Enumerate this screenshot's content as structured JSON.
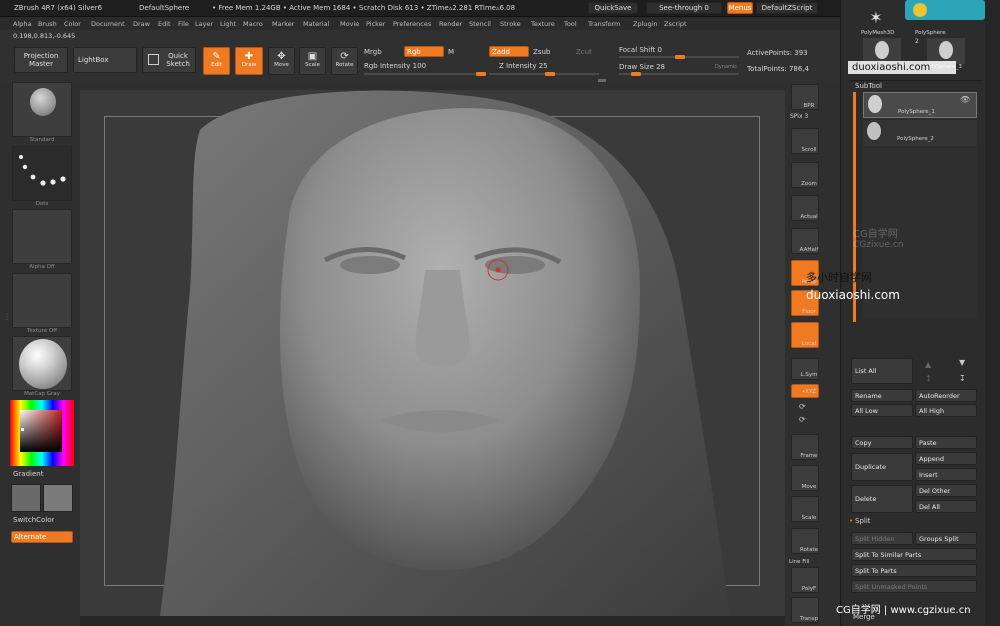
{
  "title_bar": {
    "app": "ZBrush 4R7 (x64) Silver6",
    "document": "DefaultSphere",
    "free_mem": "• Free Mem 1.24GB • Active Mem 1684 • Scratch Disk 613 • ZTime▵2.281 RTime▵6.08",
    "quicksave": "QuickSave",
    "see_through": "See-through  0",
    "menus": "Menus",
    "default_zscript": "DefaultZScript"
  },
  "coords": "0.198,0.813,-0.645",
  "menu": [
    "Alpha",
    "Brush",
    "Color",
    "Document",
    "Draw",
    "Edit",
    "File",
    "Layer",
    "Light",
    "Macro",
    "Marker",
    "Material",
    "Movie",
    "Picker",
    "Preferences",
    "Render",
    "Stencil",
    "Stroke",
    "Texture",
    "Tool",
    "Transform",
    "Zplugin",
    "Zscript"
  ],
  "shelf": {
    "projection_master": "Projection Master",
    "lightbox": "LightBox",
    "quick_sketch": "Quick Sketch",
    "edit": "Edit",
    "draw": "Draw",
    "move": "Move",
    "scale": "Scale",
    "rotate": "Rotate",
    "mrgb": "Mrgb",
    "rgb": "Rgb",
    "m": "M",
    "rgb_intensity": "Rgb Intensity 100",
    "zadd": "Zadd",
    "zsub": "Zsub",
    "zcut": "Zcut",
    "z_intensity": "Z Intensity 25",
    "focal_shift": "Focal Shift 0",
    "draw_size": "Draw Size 28",
    "dynamic": "Dynamic",
    "active_points": "ActivePoints: 393",
    "total_points": "TotalPoints: 786,4"
  },
  "left_tray": {
    "brush": "Standard",
    "stroke": "Dots",
    "alpha": "Alpha Off",
    "texture": "Texture Off",
    "material": "MatCap Gray",
    "gradient": "Gradient",
    "switch_color": "SwitchColor",
    "alternate": "Alternate"
  },
  "right_tray": {
    "bpr": "BPR",
    "spix": "SPix 3",
    "scroll": "Scroll",
    "zoom": "Zoom",
    "actual": "Actual",
    "aahalf": "AAHalf",
    "persp": "Persp",
    "floor": "Floor",
    "local": "Local",
    "lsym": "L.Sym",
    "xyz": "•XYZ",
    "frame": "Frame",
    "move": "Move",
    "scale": "Scale",
    "rotate": "Rotate",
    "line_fill": "Line Fill",
    "polyf": "PolyF",
    "transp": "Transp"
  },
  "tool_panel": {
    "polymesh": "PolyMesh3D",
    "polysphere": "PolySphere",
    "polysphere_3": "PolySphere_3",
    "count": "2",
    "subtool_header": "SubTool",
    "subtools": [
      {
        "name": "PolySphere_1"
      },
      {
        "name": "PolySphere_2"
      }
    ],
    "list_all": "List All",
    "rename": "Rename",
    "autoreorder": "AutoReorder",
    "all_low": "All Low",
    "all_high": "All High",
    "copy": "Copy",
    "paste": "Paste",
    "duplicate": "Duplicate",
    "append": "Append",
    "insert": "Insert",
    "delete": "Delete",
    "del_other": "Del Other",
    "del_all": "Del All",
    "split_header": "Split",
    "split_hidden": "Split Hidden",
    "groups_split": "Groups Split",
    "split_similar": "Split To Similar Parts",
    "split_parts": "Split To Parts",
    "split_unmasked": "Split Unmasked Points",
    "merge": "Merge"
  },
  "watermarks": {
    "site_top": "duoxiaoshi.com",
    "cg_center": "CG自学网",
    "cg_center_url": "CGzixue.cn",
    "center_cn": "多小时自学网",
    "center_url": "duoxiaoshi.com",
    "footer": "CG自学网 | www.cgzixue.cn"
  }
}
